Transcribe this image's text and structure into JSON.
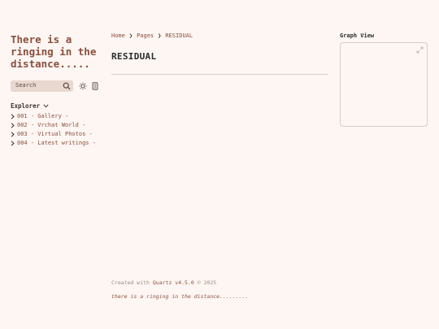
{
  "site": {
    "title": "There is a ringing in the distance....."
  },
  "search": {
    "placeholder": "Search"
  },
  "explorer": {
    "title": "Explorer",
    "items": [
      {
        "label": "001 - Gallery -"
      },
      {
        "label": "002 - Vrchat World -"
      },
      {
        "label": "003 - Virtual Photos -"
      },
      {
        "label": "004 - Latest writings -"
      }
    ]
  },
  "breadcrumb": {
    "home": "Home",
    "pages": "Pages",
    "current": "RESIDUAL",
    "separator": "❯"
  },
  "page": {
    "title": "RESIDUAL"
  },
  "graph": {
    "label": "Graph View"
  },
  "footer": {
    "created_prefix": "Created with",
    "quartz_link": "Quartz v4.5.0",
    "created_suffix": "© 2025",
    "note": "there is a ringing in the distance........."
  },
  "colors": {
    "accent": "#8a4f3c",
    "background": "#fdf6f3",
    "search_bg": "#e8d8d0",
    "divider": "#d9ccc6"
  },
  "icons": [
    "search-icon",
    "sun-icon",
    "reader-mode-icon",
    "chevron-down-icon",
    "chevron-right-icon",
    "expand-icon"
  ]
}
